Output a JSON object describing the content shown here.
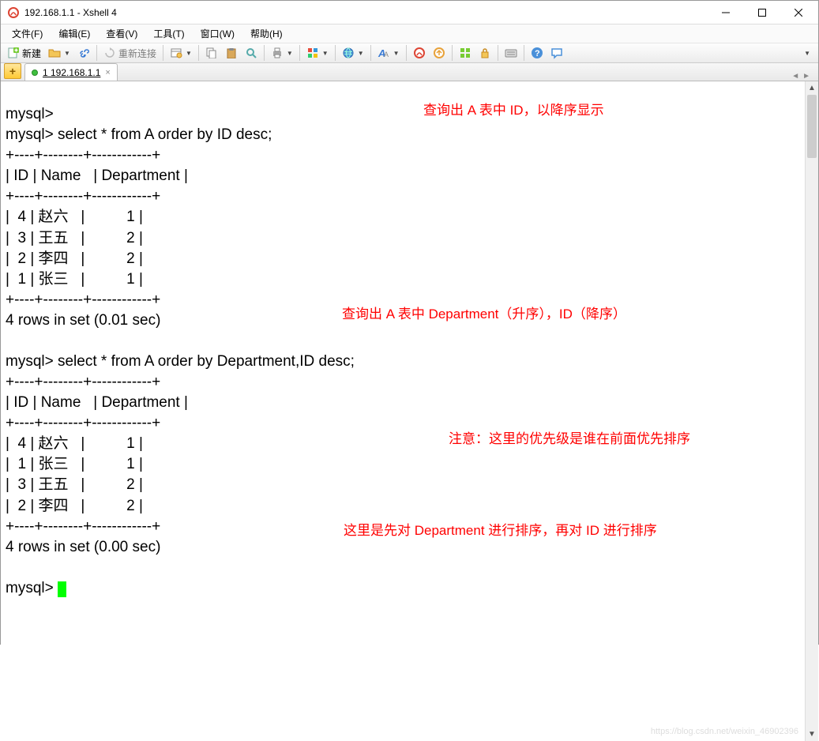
{
  "window": {
    "title": "192.168.1.1 - Xshell 4"
  },
  "menu": {
    "file": "文件(F)",
    "edit": "编辑(E)",
    "view": "查看(V)",
    "tools": "工具(T)",
    "window": "窗口(W)",
    "help": "帮助(H)"
  },
  "toolbar": {
    "new_label": "新建",
    "reconnect_label": "重新连接"
  },
  "tab": {
    "label": "1 192.168.1.1",
    "close": "×"
  },
  "terminal": {
    "line1": "mysql>",
    "line2": "mysql> select * from A order by ID desc;",
    "border": "+----+--------+------------+",
    "header": "| ID | Name   | Department |",
    "q1_r1": "|  4 | 赵六   |          1 |",
    "q1_r2": "|  3 | 王五   |          2 |",
    "q1_r3": "|  2 | 李四   |          2 |",
    "q1_r4": "|  1 | 张三   |          1 |",
    "footer1": "4 rows in set (0.01 sec)",
    "blank": "",
    "line3": "mysql> select * from A order by Department,ID desc;",
    "q2_r1": "|  4 | 赵六   |          1 |",
    "q2_r2": "|  1 | 张三   |          1 |",
    "q2_r3": "|  3 | 王五   |          2 |",
    "q2_r4": "|  2 | 李四   |          2 |",
    "footer2": "4 rows in set (0.00 sec)",
    "prompt": "mysql> "
  },
  "annotations": {
    "a1": "查询出 A 表中 ID，以降序显示",
    "a2": "查询出 A 表中 Department（升序），ID（降序）",
    "a3": "注意：这里的优先级是谁在前面优先排序",
    "a4": "这里是先对 Department 进行排序，再对 ID 进行排序"
  },
  "watermark": "https://blog.csdn.net/weixin_46902396"
}
